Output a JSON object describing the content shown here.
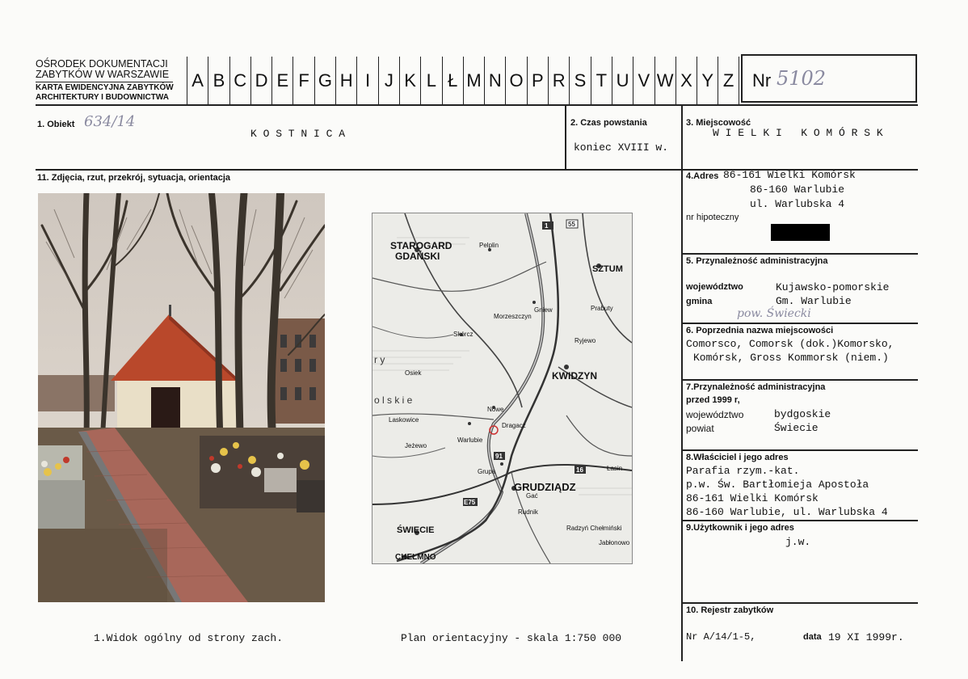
{
  "header": {
    "org_line1": "OŚRODEK DOKUMENTACJI",
    "org_line2": "ZABYTKÓW W WARSZAWIE",
    "card_line1": "KARTA EWIDENCYJNA ZABYTKÓW",
    "card_line2": "ARCHITEKTURY I BUDOWNICTWA",
    "letters": [
      "A",
      "B",
      "C",
      "D",
      "E",
      "F",
      "G",
      "H",
      "I",
      "J",
      "K",
      "L",
      "Ł",
      "M",
      "N",
      "O",
      "P",
      "R",
      "S",
      "T",
      "U",
      "V",
      "W",
      "X",
      "Y",
      "Z"
    ],
    "nr_label": "Nr",
    "nr_value": "5102"
  },
  "fields": {
    "obiekt_label": "1. Obiekt",
    "obiekt_hand": "634/14",
    "obiekt_value": "K O S T N I C A",
    "czas_label": "2. Czas powstania",
    "czas_value": "koniec XVIII w.",
    "miejscowosc_label": "3. Miejscowość",
    "miejscowosc_value": "W I E L K I   K O M Ó R S K",
    "photos_label": "11. Zdjęcia, rzut, przekrój, sytuacja, orientacja",
    "adres_label": "4.Adres",
    "adres_line1": "86-161 Wielki Komórsk",
    "adres_line2": "86-160 Warlubie",
    "adres_line3": "ul. Warlubska 4",
    "hipoteczny_label": "nr hipoteczny",
    "przyn_label": "5. Przynależność administracyjna",
    "wojewodztwo_label": "województwo",
    "wojewodztwo_value": "Kujawsko-pomorskie",
    "gmina_label": "gmina",
    "gmina_value": "Gm. Warlubie",
    "pow_hand": "pow. Świecki",
    "poprz_label": "6. Poprzednia nazwa miejscowości",
    "poprz_line1": "Comorsco, Comorsk (dok.)Komorsko,",
    "poprz_line2": "Komórsk, Gross Kommorsk (niem.)",
    "przyn1999_label1": "7.Przynależność administracyjna",
    "przyn1999_label2": "przed 1999 r,",
    "woj1999_label": "województwo",
    "woj1999_value": "bydgoskie",
    "powiat_label": "powiat",
    "powiat_value": "Świecie",
    "wlasciciel_label": "8.Właściciel i jego adres",
    "wlasciciel_line1": "Parafia rzym.-kat.",
    "wlasciciel_line2": "p.w. Św. Bartłomieja Apostoła",
    "wlasciciel_line3": "86-161 Wielki Komórsk",
    "wlasciciel_line4": "86-160 Warlubie, ul. Warlubska 4",
    "uzytkownik_label": "9.Użytkownik i jego adres",
    "uzytkownik_value": "j.w.",
    "rejestr_label": "10. Rejestr zabytków",
    "rejestr_nr": "Nr A/14/1-5,",
    "rejestr_data_label": "data",
    "rejestr_data_value": "19 XI 1999r."
  },
  "captions": {
    "photo": "1.Widok ogólny od strony zach.",
    "map": "Plan orientacyjny - skala 1:750 000"
  },
  "map": {
    "towns_bold": [
      "STAROGARD GDAŃSKI",
      "SZTUM",
      "KWIDZYN",
      "GRUDZIĄDZ",
      "ŚWIECIE",
      "CHEŁMNO"
    ],
    "towns": [
      "Pelplin",
      "Gniew",
      "Skórcz",
      "Nowe",
      "Warlubie",
      "Dragacz",
      "Grupa",
      "Gać",
      "Rudnik",
      "Laskowice",
      "Jeżewo",
      "Wielki Komórsk",
      "Łasin",
      "Radzyń Chełmiński",
      "Jabłonowo",
      "Kwidzyn",
      "Prabuty",
      "Ryjewo",
      "Morzeszczyn",
      "Osiek"
    ],
    "road_numbers": [
      "1",
      "55",
      "91",
      "16",
      "E75"
    ]
  }
}
